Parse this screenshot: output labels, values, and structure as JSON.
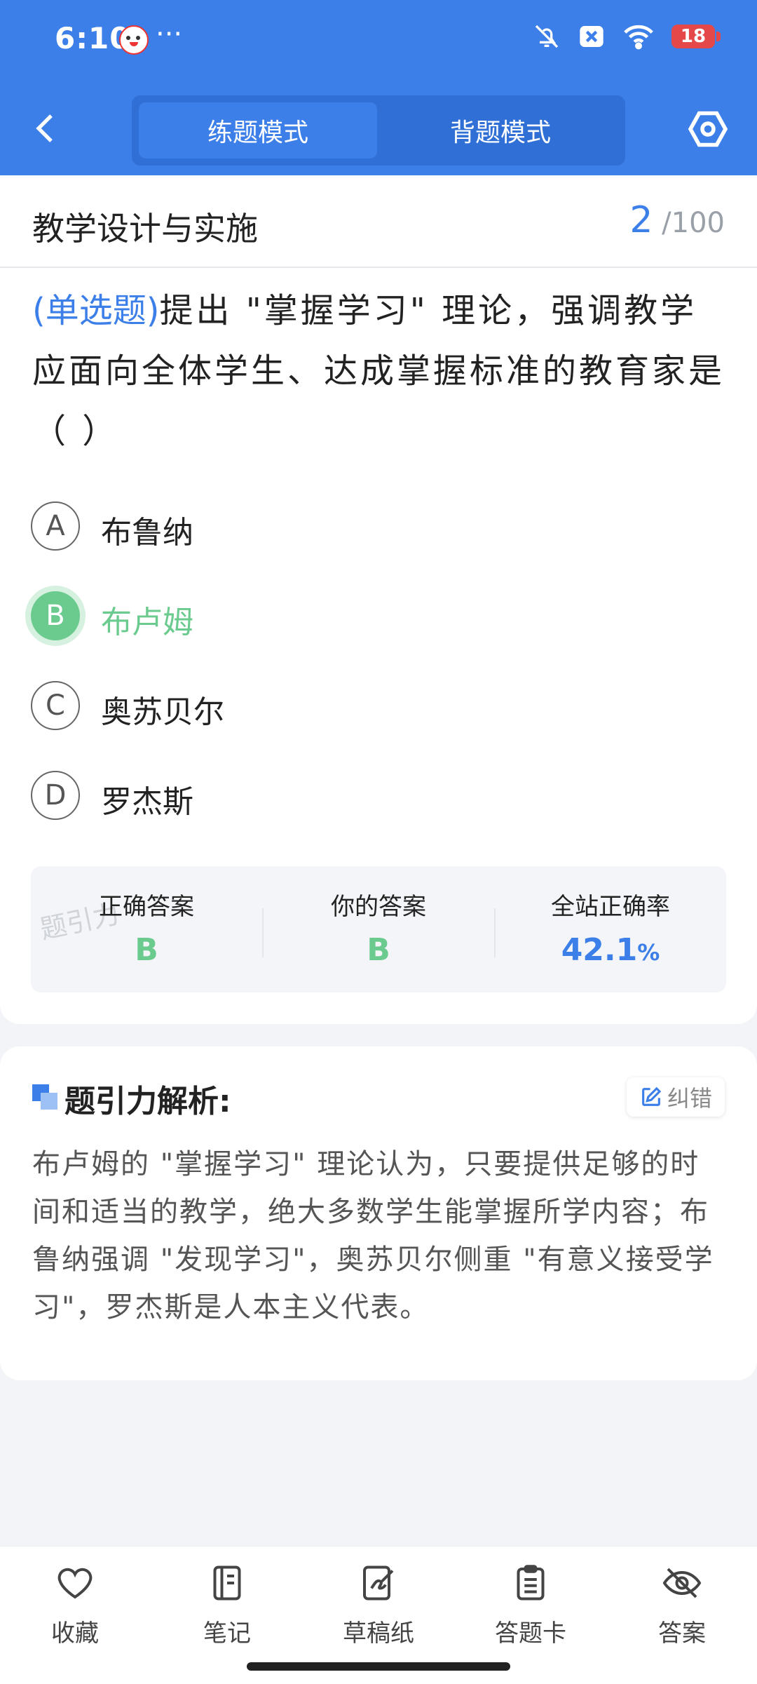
{
  "status_bar": {
    "time": "6:10",
    "more": "···",
    "battery": "18"
  },
  "header": {
    "tab_practice": "练题模式",
    "tab_recite": "背题模式"
  },
  "subject": {
    "title": "教学设计与实施",
    "current": "2",
    "separator": "/",
    "total": "100"
  },
  "question": {
    "type": "(单选题)",
    "text": "提出 \"掌握学习\" 理论，强调教学应面向全体学生、达成掌握标准的教育家是（ ）",
    "options": [
      {
        "letter": "A",
        "text": "布鲁纳"
      },
      {
        "letter": "B",
        "text": "布卢姆"
      },
      {
        "letter": "C",
        "text": "奥苏贝尔"
      },
      {
        "letter": "D",
        "text": "罗杰斯"
      }
    ],
    "selected": "B"
  },
  "stats": {
    "correct_label": "正确答案",
    "correct_value": "B",
    "yours_label": "你的答案",
    "yours_value": "B",
    "rate_label": "全站正确率",
    "rate_value": "42.1",
    "rate_unit": "%",
    "watermark": "题引力"
  },
  "explanation": {
    "title": "题引力解析:",
    "report_label": "纠错",
    "text": "布卢姆的 \"掌握学习\" 理论认为，只要提供足够的时间和适当的教学，绝大多数学生能掌握所学内容；布鲁纳强调 \"发现学习\"，奥苏贝尔侧重 \"有意义接受学习\"，罗杰斯是人本主义代表。"
  },
  "bottom_nav": [
    {
      "label": "收藏",
      "icon": "heart-icon"
    },
    {
      "label": "笔记",
      "icon": "notebook-icon"
    },
    {
      "label": "草稿纸",
      "icon": "draft-icon"
    },
    {
      "label": "答题卡",
      "icon": "clipboard-icon"
    },
    {
      "label": "答案",
      "icon": "eye-off-icon"
    }
  ],
  "colors": {
    "primary": "#3c7fe8",
    "correct": "#6bcb8f",
    "battery": "#e54848"
  }
}
